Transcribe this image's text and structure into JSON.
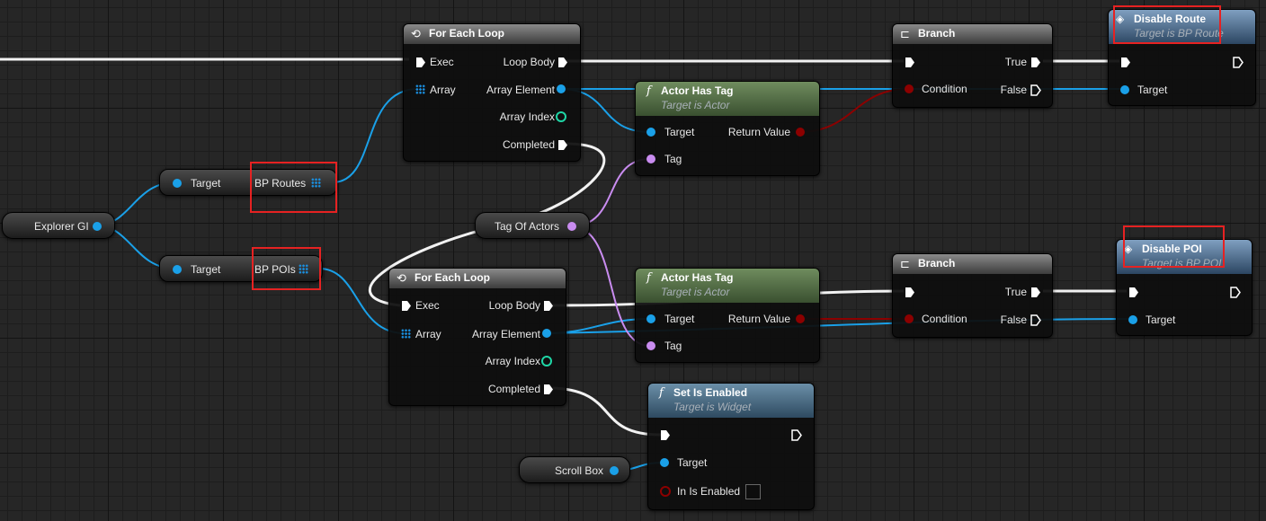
{
  "colors": {
    "exec": "#ffffff",
    "object": "#1aa0e8",
    "bool": "#8c0000",
    "name": "#c98cf0",
    "int": "#1fd6a6"
  },
  "nodes": {
    "for_each_1": {
      "title": "For Each Loop",
      "exec": "Exec",
      "array": "Array",
      "loop_body": "Loop Body",
      "array_element": "Array Element",
      "array_index": "Array Index",
      "completed": "Completed"
    },
    "for_each_2": {
      "title": "For Each Loop",
      "exec": "Exec",
      "array": "Array",
      "loop_body": "Loop Body",
      "array_element": "Array Element",
      "array_index": "Array Index",
      "completed": "Completed"
    },
    "actor_has_tag_1": {
      "title": "Actor Has Tag",
      "subtitle": "Target is Actor",
      "target": "Target",
      "tag": "Tag",
      "return_value": "Return Value"
    },
    "actor_has_tag_2": {
      "title": "Actor Has Tag",
      "subtitle": "Target is Actor",
      "target": "Target",
      "tag": "Tag",
      "return_value": "Return Value"
    },
    "branch_1": {
      "title": "Branch",
      "condition": "Condition",
      "true": "True",
      "false": "False"
    },
    "branch_2": {
      "title": "Branch",
      "condition": "Condition",
      "true": "True",
      "false": "False"
    },
    "disable_route": {
      "title": "Disable Route",
      "subtitle": "Target is BP Route",
      "target": "Target"
    },
    "disable_poi": {
      "title": "Disable POI",
      "subtitle": "Target is BP POI",
      "target": "Target"
    },
    "set_is_enabled": {
      "title": "Set Is Enabled",
      "subtitle": "Target is Widget",
      "target": "Target",
      "in_is_enabled": "In Is Enabled"
    },
    "get_routes": {
      "target": "Target",
      "output": "BP Routes"
    },
    "get_pois": {
      "target": "Target",
      "output": "BP POIs"
    }
  },
  "variables": {
    "explorer_gi": "Explorer GI",
    "tag_of_actors": "Tag Of Actors",
    "scroll_box": "Scroll Box"
  },
  "icons": {
    "loop": "loop-icon",
    "function": "function-icon",
    "branch": "branch-icon",
    "event": "custom-event-icon"
  }
}
